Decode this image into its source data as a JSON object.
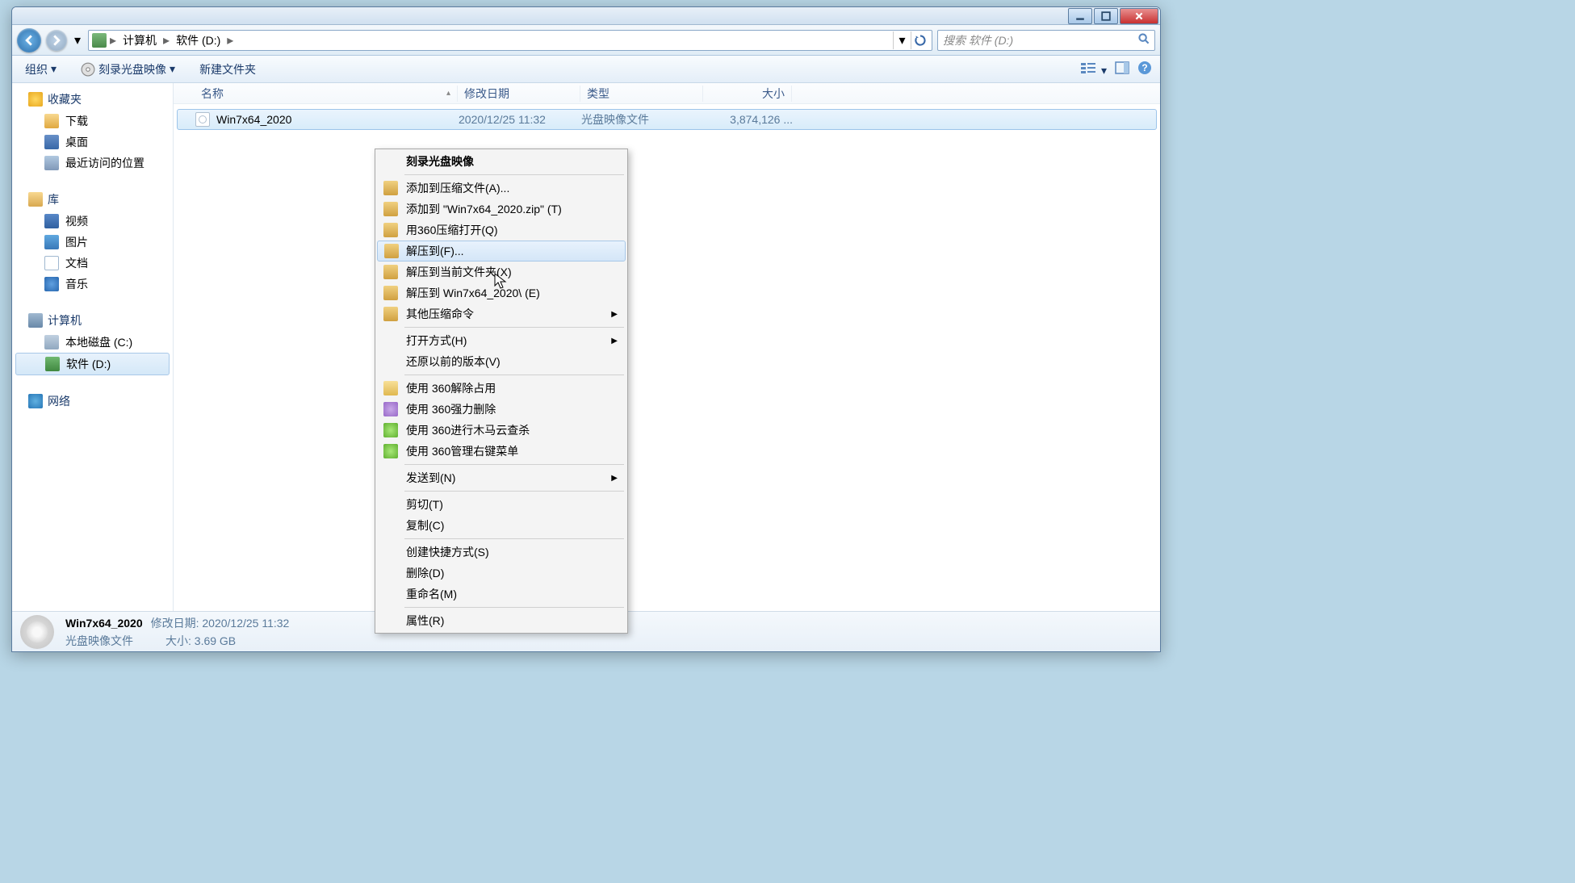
{
  "breadcrumb": {
    "seg1": "计算机",
    "seg2": "软件 (D:)"
  },
  "search": {
    "placeholder": "搜索 软件 (D:)"
  },
  "toolbar": {
    "organize": "组织",
    "burn": "刻录光盘映像",
    "newfolder": "新建文件夹"
  },
  "sidebar": {
    "fav": "收藏夹",
    "downloads": "下载",
    "desktop": "桌面",
    "recent": "最近访问的位置",
    "libraries": "库",
    "videos": "视频",
    "pictures": "图片",
    "documents": "文档",
    "music": "音乐",
    "computer": "计算机",
    "local_c": "本地磁盘 (C:)",
    "software_d": "软件 (D:)",
    "network": "网络"
  },
  "columns": {
    "name": "名称",
    "date": "修改日期",
    "type": "类型",
    "size": "大小"
  },
  "file": {
    "name": "Win7x64_2020",
    "date": "2020/12/25 11:32",
    "type": "光盘映像文件",
    "size": "3,874,126 ..."
  },
  "status": {
    "filename": "Win7x64_2020",
    "date_label": "修改日期:",
    "date_value": "2020/12/25 11:32",
    "type": "光盘映像文件",
    "size_label": "大小:",
    "size_value": "3.69 GB"
  },
  "context": {
    "burn": "刻录光盘映像",
    "add_archive": "添加到压缩文件(A)...",
    "add_zip": "添加到 \"Win7x64_2020.zip\" (T)",
    "open_360zip": "用360压缩打开(Q)",
    "extract_to": "解压到(F)...",
    "extract_here": "解压到当前文件夹(X)",
    "extract_folder": "解压到 Win7x64_2020\\ (E)",
    "other_zip": "其他压缩命令",
    "open_with": "打开方式(H)",
    "restore_ver": "还原以前的版本(V)",
    "unlock360": "使用 360解除占用",
    "force_del360": "使用 360强力删除",
    "trojan360": "使用 360进行木马云查杀",
    "menu360": "使用 360管理右键菜单",
    "send_to": "发送到(N)",
    "cut": "剪切(T)",
    "copy": "复制(C)",
    "shortcut": "创建快捷方式(S)",
    "delete": "删除(D)",
    "rename": "重命名(M)",
    "properties": "属性(R)"
  }
}
